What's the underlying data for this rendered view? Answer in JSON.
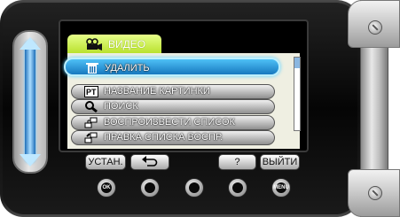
{
  "menu": {
    "title": "ВИДЕО",
    "items": [
      {
        "label": "УДАЛИТЬ",
        "icon": "trash-icon",
        "selected": true
      },
      {
        "label": "НАЗВАНИЕ КАРТИНКИ",
        "icon": "event-tag-icon"
      },
      {
        "label": "ПОИСК",
        "icon": "search-icon"
      },
      {
        "label": "ВОСПРОИЗВЕСТИ СПИСОК",
        "icon": "playlist-play-icon"
      },
      {
        "label": "ПРАВКА СПИСКА ВОСПР.",
        "icon": "playlist-edit-icon"
      }
    ]
  },
  "softkeys": {
    "set": "УСТАН.",
    "back_icon": "return-arrow-icon",
    "help": "?",
    "exit": "ВЫЙТИ"
  },
  "hardware_buttons": {
    "ok": "OK",
    "menu": "MENU"
  },
  "colors": {
    "selection": "#1f8fd6",
    "tab": "#c8ee3a",
    "panel": "#efefe2"
  }
}
